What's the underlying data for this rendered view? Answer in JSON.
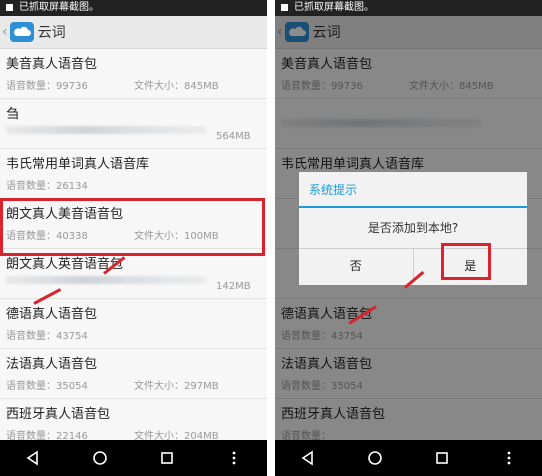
{
  "status_text": "已抓取屏幕截图。",
  "app_title": "云词",
  "label_count": "语音数量：",
  "label_size": "文件大小：",
  "items": [
    {
      "name": "美音真人语音包",
      "count": "99736",
      "size": "845MB"
    },
    {
      "name": "刍",
      "count": "",
      "size": "564MB"
    },
    {
      "name": "韦氏常用单词真人语音库",
      "count": "26134",
      "size": ""
    },
    {
      "name": "朗文真人美音语音包",
      "count": "40338",
      "size": "100MB"
    },
    {
      "name": "朗文真人英音语音包",
      "count": "",
      "size": "142MB"
    },
    {
      "name": "德语真人语音包",
      "count": "43754",
      "size": ""
    },
    {
      "name": "法语真人语音包",
      "count": "35054",
      "size": "297MB"
    },
    {
      "name": "西班牙真人语音包",
      "count": "22146",
      "size": "204MB"
    }
  ],
  "dialog": {
    "title": "系统提示",
    "message": "是否添加到本地?",
    "no_label": "否",
    "yes_label": "是"
  },
  "colors": {
    "accent": "#1a9bd6",
    "highlight": "#d9232d",
    "statusbar": "#222222",
    "navbar": "#000000"
  },
  "icons": {
    "back": "chevron-left-icon",
    "app": "cloud-icon",
    "nav": [
      "back-triangle-icon",
      "home-circle-icon",
      "recents-square-icon",
      "menu-dots-icon"
    ]
  }
}
